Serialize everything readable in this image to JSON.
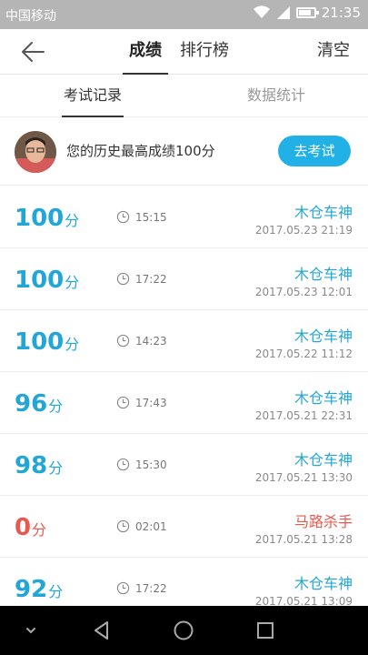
{
  "status": {
    "carrier": "中国移动",
    "time": "21:35",
    "battery_level": 0.8
  },
  "header": {
    "tabs": [
      {
        "label": "成绩",
        "active": true
      },
      {
        "label": "排行榜",
        "active": false
      }
    ],
    "clear_label": "清空"
  },
  "subtabs": [
    {
      "label": "考试记录",
      "active": true
    },
    {
      "label": "数据统计",
      "active": false
    }
  ],
  "best": {
    "text": "您的历史最高成绩100分",
    "button_label": "去考试"
  },
  "records": [
    {
      "score": "100",
      "unit": "分",
      "duration": "15:15",
      "name": "木仓车神",
      "date": "2017.05.23  21:19",
      "passed": true
    },
    {
      "score": "100",
      "unit": "分",
      "duration": "17:22",
      "name": "木仓车神",
      "date": "2017.05.23  12:01",
      "passed": true
    },
    {
      "score": "100",
      "unit": "分",
      "duration": "14:23",
      "name": "木仓车神",
      "date": "2017.05.22  11:12",
      "passed": true
    },
    {
      "score": "96",
      "unit": "分",
      "duration": "17:43",
      "name": "木仓车神",
      "date": "2017.05.21  22:31",
      "passed": true
    },
    {
      "score": "98",
      "unit": "分",
      "duration": "15:30",
      "name": "木仓车神",
      "date": "2017.05.21  13:30",
      "passed": true
    },
    {
      "score": "0",
      "unit": "分",
      "duration": "02:01",
      "name": "马路杀手",
      "date": "2017.05.21  13:28",
      "passed": false
    },
    {
      "score": "92",
      "unit": "分",
      "duration": "17:22",
      "name": "木仓车神",
      "date": "2017.05.21  13:09",
      "passed": true
    }
  ],
  "colors": {
    "accent": "#22a6d8",
    "button": "#22b1e6",
    "fail": "#e85a4f"
  },
  "icons": {
    "back": "arrow-left-icon",
    "clock": "clock-icon",
    "nav": [
      "chevron-down-icon",
      "back-triangle-icon",
      "home-circle-icon",
      "recents-square-icon"
    ]
  }
}
